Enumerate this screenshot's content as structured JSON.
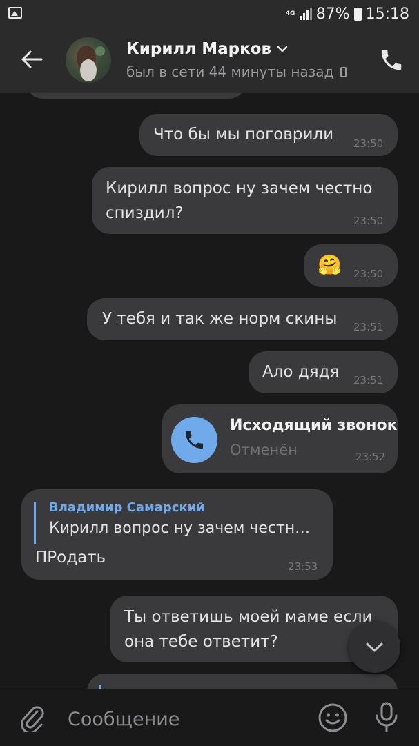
{
  "status_bar": {
    "network": "4G",
    "battery": "87%",
    "time": "15:18"
  },
  "header": {
    "name": "Кирилл Марков",
    "last_seen": "был в сети 44 минуты назад"
  },
  "messages": [
    {
      "type": "text",
      "lines": [
        "Что бы мы поговрили"
      ],
      "time": "23:50"
    },
    {
      "type": "text",
      "lines": [
        "Кирилл вопрос ну зачем честно",
        "спиздил?"
      ],
      "time": "23:50"
    },
    {
      "type": "emoji",
      "emoji": "🤗",
      "time": "23:50"
    },
    {
      "type": "text",
      "lines": [
        "У тебя и так же норм скины"
      ],
      "time": "23:51"
    },
    {
      "type": "text",
      "lines": [
        "Ало дядя"
      ],
      "time": "23:51"
    },
    {
      "type": "call",
      "title": "Исходящий звонок",
      "status": "Отменён",
      "time": "23:52"
    },
    {
      "type": "reply",
      "author": "Владимир Самарский",
      "quote": "Кирилл вопрос ну зачем честн…",
      "text": "ПРодать",
      "time": "23:53"
    },
    {
      "type": "text",
      "lines": [
        "Ты ответишь моей маме если",
        "она тебе ответит?"
      ],
      "time": ""
    }
  ],
  "composer": {
    "placeholder": "Сообщение"
  },
  "colors": {
    "background": "#19191a",
    "bar": "#2b2b2c",
    "bubble": "#3a3a3c",
    "accent": "#71aaeb"
  }
}
